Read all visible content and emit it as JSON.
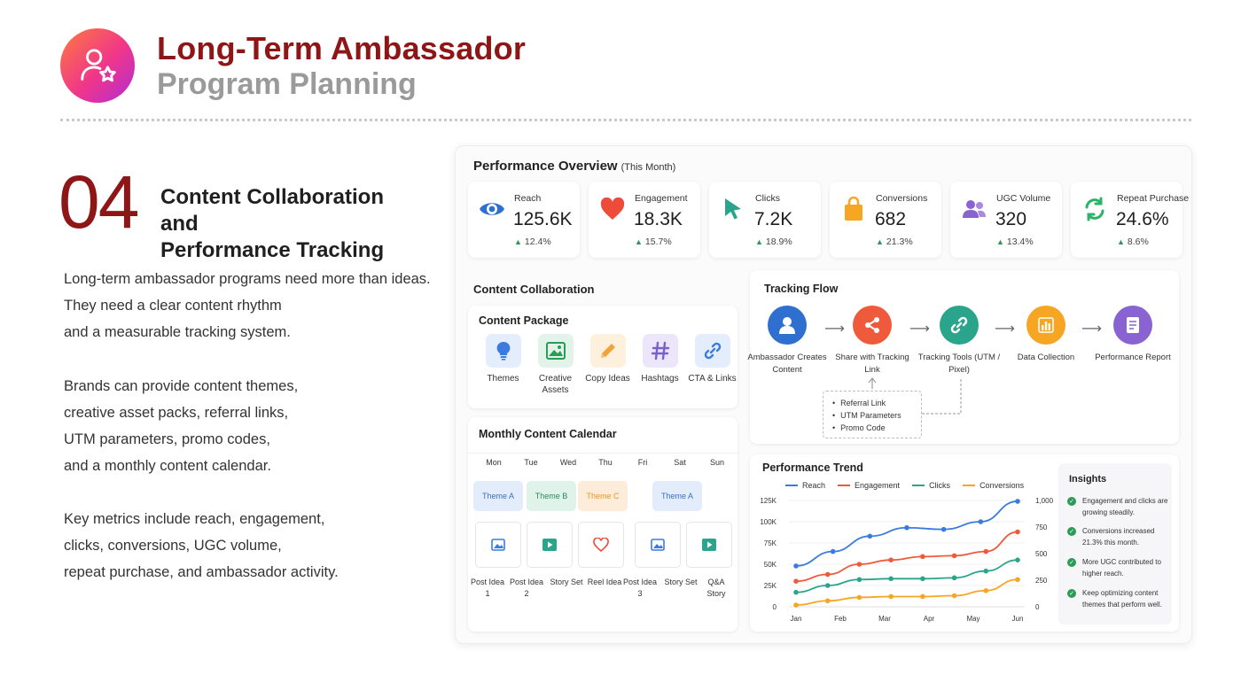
{
  "header": {
    "title_line1": "Long-Term Ambassador",
    "title_line2": "Program Planning",
    "logo_icon": "user-star-icon"
  },
  "section": {
    "number": "04",
    "title_line1": "Content Collaboration and",
    "title_line2": "Performance Tracking"
  },
  "body": {
    "para1": [
      "Long-term ambassador programs need more than ideas.",
      "They need a clear content rhythm",
      "and a measurable tracking system."
    ],
    "para2": [
      "Brands can provide content themes,",
      "creative asset packs, referral links,",
      "UTM parameters, promo codes,",
      "and a monthly content calendar."
    ],
    "para3": [
      "Key metrics include reach, engagement,",
      "clicks, conversions, UGC volume,",
      "repeat purchase, and ambassador activity."
    ]
  },
  "dashboard": {
    "title": "Performance Overview",
    "subtitle": "(This Month)",
    "kpis": [
      {
        "label": "Reach",
        "value": "125.6K",
        "change": "12.4%",
        "icon": "eye-icon",
        "color": "#2f6fd0"
      },
      {
        "label": "Engagement",
        "value": "18.3K",
        "change": "15.7%",
        "icon": "heart-icon",
        "color": "#ef4b3b"
      },
      {
        "label": "Clicks",
        "value": "7.2K",
        "change": "18.9%",
        "icon": "cursor-icon",
        "color": "#2aa58b"
      },
      {
        "label": "Conversions",
        "value": "682",
        "change": "21.3%",
        "icon": "shopping-bag-icon",
        "color": "#f6a623"
      },
      {
        "label": "UGC Volume",
        "value": "320",
        "change": "13.4%",
        "icon": "users-icon",
        "color": "#8a63d2"
      },
      {
        "label": "Repeat Purchase",
        "value": "24.6%",
        "change": "8.6%",
        "icon": "refresh-icon",
        "color": "#2bb36a"
      }
    ],
    "collab_title": "Content Collaboration",
    "package": {
      "title": "Content Package",
      "items": [
        {
          "label": "Themes",
          "icon": "lightbulb-icon",
          "bg": "#e3edfc",
          "color": "#3b7be0"
        },
        {
          "label": "Creative Assets",
          "icon": "image-icon",
          "bg": "#e2f4ea",
          "color": "#2b9b55"
        },
        {
          "label": "Copy Ideas",
          "icon": "pencil-icon",
          "bg": "#fdf0dc",
          "color": "#f2a23a"
        },
        {
          "label": "Hashtags",
          "icon": "hashtag-icon",
          "bg": "#ece6fa",
          "color": "#7b5fd0"
        },
        {
          "label": "CTA & Links",
          "icon": "link-icon",
          "bg": "#e3edfc",
          "color": "#3b7be0"
        }
      ]
    },
    "calendar": {
      "title": "Monthly Content Calendar",
      "days": [
        "Mon",
        "Tue",
        "Wed",
        "Thu",
        "Fri",
        "Sat",
        "Sun"
      ],
      "themes": [
        {
          "label": "Theme A",
          "bg": "#e2ecfb",
          "color": "#3b6fc4"
        },
        {
          "label": "Theme B",
          "bg": "#dff3ea",
          "color": "#2b8a5a"
        },
        {
          "label": "Theme C",
          "bg": "#fcecd9",
          "color": "#e8962f"
        },
        {
          "label": "Theme A",
          "bg": "#e2ecfb",
          "color": "#3b6fc4"
        }
      ],
      "posts": [
        {
          "label": "Post Idea 1",
          "icon": "image-icon",
          "color": "#3b7be0"
        },
        {
          "label": "Post Idea 2",
          "icon": "play-icon",
          "color": "#2aa58b"
        },
        {
          "label": "Story Set",
          "icon": "",
          "color": ""
        },
        {
          "label": "Reel Idea",
          "icon": "heart-outline-icon",
          "color": "#ef4b3b"
        },
        {
          "label": "Post Idea 3",
          "icon": "image-icon",
          "color": "#3b7be0"
        },
        {
          "label": "Story Set",
          "icon": "play-icon",
          "color": "#2aa58b"
        },
        {
          "label": "Q&A Story",
          "icon": "",
          "color": ""
        }
      ]
    },
    "tracking": {
      "title": "Tracking Flow",
      "nodes": [
        {
          "label": "Ambassador Creates Content",
          "icon": "user-icon",
          "color": "#2f6fd0"
        },
        {
          "label": "Share with Tracking Link",
          "icon": "share-icon",
          "color": "#ef5a3c"
        },
        {
          "label": "Tracking Tools (UTM / Pixel)",
          "icon": "link-icon",
          "color": "#2aa58b"
        },
        {
          "label": "Data Collection",
          "icon": "bar-chart-icon",
          "color": "#f6a623"
        },
        {
          "label": "Performance Report",
          "icon": "report-icon",
          "color": "#8a63d2"
        }
      ],
      "ref_items": [
        "Referral Link",
        "UTM Parameters",
        "Promo Code"
      ]
    },
    "trend": {
      "title": "Performance Trend",
      "insights_title": "Insights",
      "insights": [
        "Engagement and clicks are growing steadily.",
        "Conversions increased 21.3% this month.",
        "More UGC contributed to higher reach.",
        "Keep optimizing content themes that perform well."
      ]
    }
  },
  "chart_data": {
    "type": "line",
    "title": "Performance Trend",
    "categories": [
      "Jan",
      "Feb",
      "Mar",
      "Apr",
      "May",
      "Jun"
    ],
    "left_axis": {
      "ticks": [
        "0",
        "25K",
        "50K",
        "75K",
        "100K",
        "125K"
      ],
      "ylim": [
        0,
        125000
      ]
    },
    "right_axis": {
      "ticks": [
        "0",
        "250",
        "500",
        "750",
        "1,000"
      ],
      "ylim": [
        0,
        1000
      ]
    },
    "series": [
      {
        "name": "Reach",
        "color": "#3b7be0",
        "axis": "left",
        "values": [
          48000,
          65000,
          83000,
          93000,
          91000,
          100000,
          124000
        ],
        "x": [
          0,
          0.5,
          1,
          1.5,
          2,
          2.5,
          3
        ]
      },
      {
        "name": "Engagement",
        "color": "#ef5a3c",
        "axis": "left",
        "values": [
          30000,
          38000,
          50000,
          55000,
          59000,
          60000,
          65000,
          88000
        ],
        "x": [
          0,
          0.5,
          1,
          1.5,
          2,
          2.5,
          3,
          3.5
        ]
      },
      {
        "name": "Clicks",
        "color": "#2aa58b",
        "axis": "left",
        "values": [
          17000,
          25000,
          32000,
          33000,
          33000,
          34000,
          42000,
          55000
        ],
        "x": [
          0,
          0.5,
          1,
          1.5,
          2,
          2.5,
          3,
          3.5
        ]
      },
      {
        "name": "Conversions",
        "color": "#f6a623",
        "axis": "left",
        "values": [
          2000,
          7000,
          11000,
          12000,
          12000,
          13000,
          19000,
          32000
        ],
        "x": [
          0,
          0.5,
          1,
          1.5,
          2,
          2.5,
          3,
          3.5
        ]
      }
    ],
    "legend_position": "top",
    "grid": true
  }
}
